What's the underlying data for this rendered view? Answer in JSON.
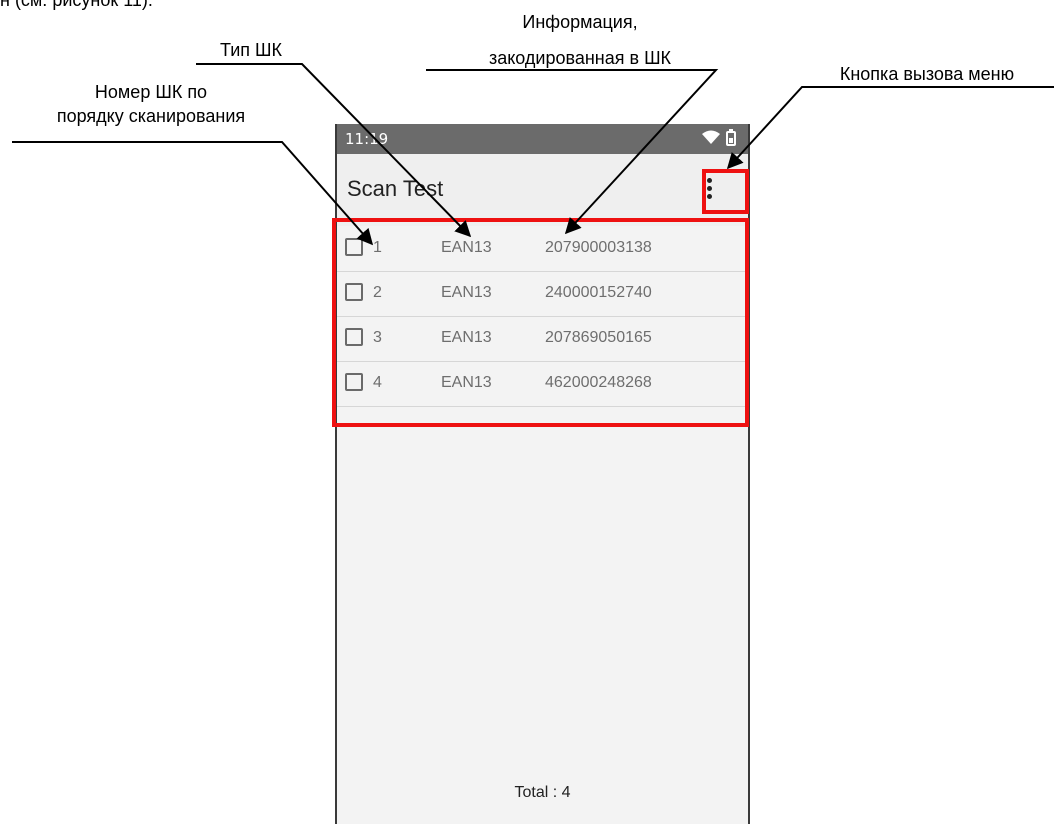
{
  "cut_text": "н (см. рисунок 11).",
  "annotations": {
    "barcode_number": [
      "Номер ШК по",
      "порядку сканирования"
    ],
    "barcode_type": "Тип ШК",
    "barcode_info": [
      "Информация,",
      "закодированная в ШК"
    ],
    "menu_button": "Кнопка вызова меню"
  },
  "phone": {
    "status_time": "11:19",
    "app_title": "Scan Test",
    "rows": [
      {
        "num": "1",
        "type": "EAN13",
        "code": "207900003138"
      },
      {
        "num": "2",
        "type": "EAN13",
        "code": "240000152740"
      },
      {
        "num": "3",
        "type": "EAN13",
        "code": "207869050165"
      },
      {
        "num": "4",
        "type": "EAN13",
        "code": "462000248268"
      }
    ],
    "total": "Total : 4"
  },
  "colors": {
    "highlight": "#ee1111",
    "status_bar": "#6b6b6b"
  }
}
